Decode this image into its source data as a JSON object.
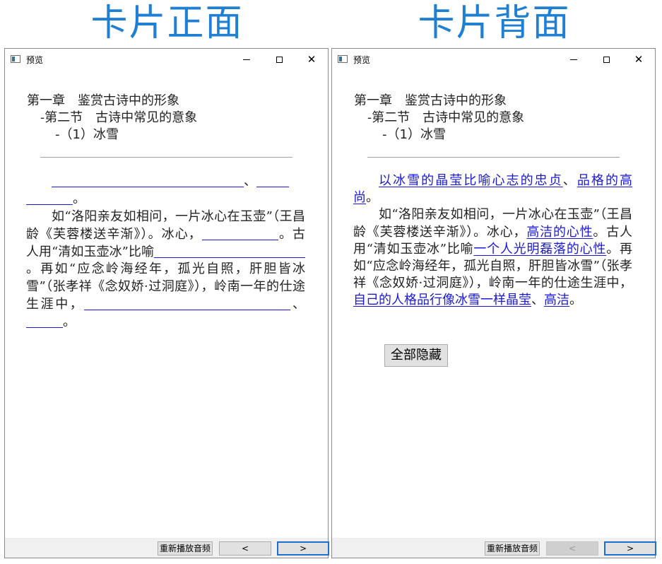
{
  "headings": {
    "front": "卡片正面",
    "back": "卡片背面"
  },
  "window": {
    "title": "预览",
    "close_glyph": "✕"
  },
  "breadcrumb": {
    "chapter": "第一章　鉴赏古诗中的形象",
    "section": "-第二节　古诗中常见的意象",
    "item": "-（1）冰雪"
  },
  "passage": {
    "sep1": "、",
    "end1": "。",
    "s2": "如“洛阳亲友如相问，一片冰心在玉壶”（王昌龄《芙蓉楼送辛渐》）。冰心，",
    "s3": "。古人用“清如玉壶冰”比喻",
    "s4": "。再如“应念岭海经年，孤光自照，肝胆皆冰雪”（张孝祥《念奴娇·过洞庭》），岭南一年的仕途生涯中，",
    "sep2": "、",
    "end2": "。"
  },
  "answers": {
    "a1": "以冰雪的晶莹比喻心志的忠贞",
    "a2": "品格的高尚",
    "a3": "高洁的心性",
    "a4": "一个人光明磊落的心性",
    "a5": "自己的人格品行像冰雪一样晶莹",
    "a6": "高洁"
  },
  "buttons": {
    "hide_all": "全部隐藏",
    "replay": "重新播放音频",
    "prev": "<",
    "next": ">"
  },
  "state": {
    "back_prev_disabled": true
  }
}
